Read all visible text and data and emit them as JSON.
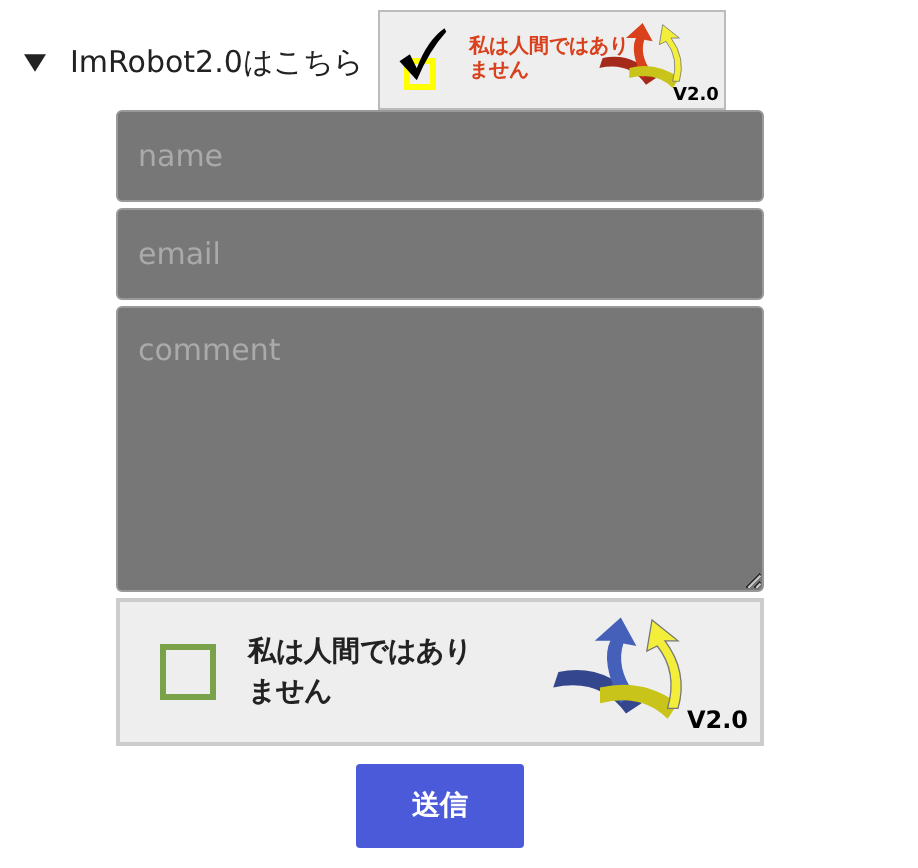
{
  "disclosure": {
    "label": "ImRobot2.0はこちら",
    "expanded": true
  },
  "badge": {
    "label": "私は人間ではありません",
    "version": "V2.0",
    "checked": true
  },
  "fields": [
    {
      "kind": "line",
      "placeholder": "name"
    },
    {
      "kind": "line",
      "placeholder": "email"
    },
    {
      "kind": "area",
      "placeholder": "comment"
    }
  ],
  "captcha": {
    "label": "私は人間ではありません",
    "version": "V2.0",
    "checked": false
  },
  "submit": "送信"
}
